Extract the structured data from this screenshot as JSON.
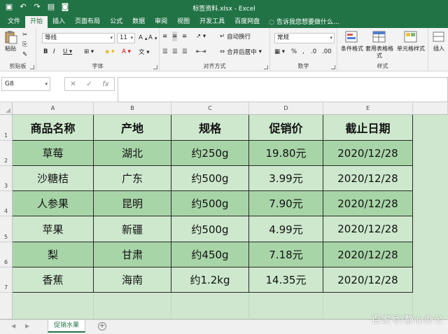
{
  "window": {
    "title": "标签资料.xlsx - Excel"
  },
  "quick_access": {
    "save_icon": "save-icon",
    "undo_icon": "undo-icon",
    "redo_icon": "redo-icon",
    "print_icon": "print-preview-icon",
    "camera_icon": "camera-icon"
  },
  "tabs": [
    "文件",
    "开始",
    "插入",
    "页面布局",
    "公式",
    "数据",
    "审阅",
    "视图",
    "开发工具",
    "百度网盘"
  ],
  "active_tab": "开始",
  "tell_me": "告诉我您想要做什么...",
  "ribbon": {
    "clipboard": {
      "paste": "粘贴",
      "label": "剪贴板"
    },
    "font": {
      "name": "等线",
      "size": "11",
      "label": "字体"
    },
    "alignment": {
      "wrap": "自动换行",
      "merge": "合并后居中",
      "label": "对齐方式"
    },
    "number": {
      "format": "常规",
      "label": "数字"
    },
    "styles": {
      "conditional": "条件格式",
      "table": "套用表格格式",
      "cell": "单元格样式",
      "label": "样式"
    },
    "insert": "插入"
  },
  "formula_bar": {
    "name_box": "G8",
    "fx": "fx",
    "formula": ""
  },
  "grid": {
    "columns": [
      "A",
      "B",
      "C",
      "D",
      "E"
    ],
    "rows": [
      "1",
      "2",
      "3",
      "4",
      "5",
      "6",
      "7"
    ],
    "headers": [
      "商品名称",
      "产地",
      "规格",
      "促销价",
      "截止日期"
    ],
    "data": [
      [
        "草莓",
        "湖北",
        "约250g",
        "19.80元",
        "2020/12/28"
      ],
      [
        "沙糖桔",
        "广东",
        "约500g",
        "3.99元",
        "2020/12/28"
      ],
      [
        "人参果",
        "昆明",
        "约500g",
        "7.90元",
        "2020/12/28"
      ],
      [
        "苹果",
        "新疆",
        "约500g",
        "4.99元",
        "2020/12/28"
      ],
      [
        "梨",
        "甘肃",
        "约450g",
        "7.18元",
        "2020/12/28"
      ],
      [
        "香蕉",
        "海南",
        "约1.2kg",
        "14.35元",
        "2020/12/28"
      ]
    ],
    "colors": {
      "header_fill": "#cde8cd",
      "band_dark": "#a8d5a8",
      "band_light": "#cde8cd"
    }
  },
  "sheet_tabs": {
    "active": "促销水果"
  },
  "watermark": "百家号/静心办公"
}
